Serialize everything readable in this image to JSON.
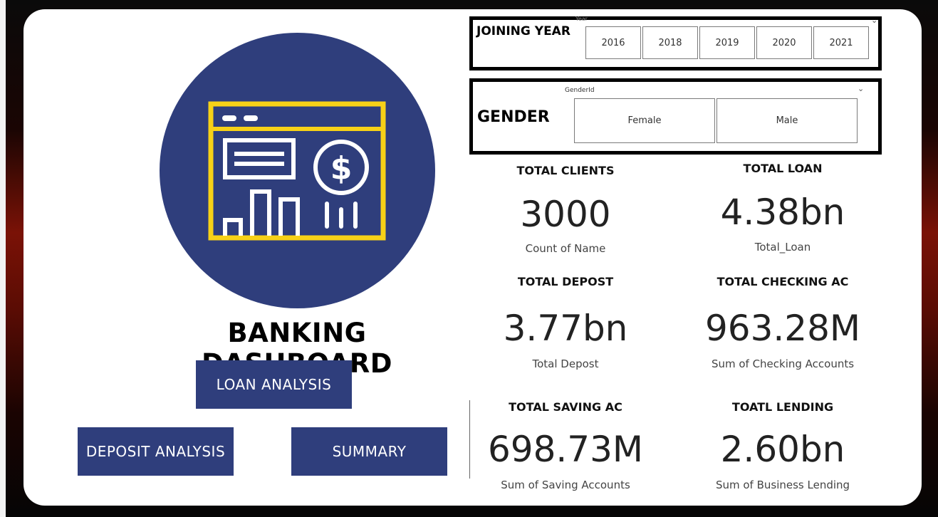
{
  "dashboard": {
    "title": "BANKING DASHBOARD",
    "logo_icon": "banking-dashboard-icon"
  },
  "navigation": {
    "loan_analysis": "LOAN ANALYSIS",
    "deposit_analysis": "DEPOSIT ANALYSIS",
    "summary": "SUMMARY"
  },
  "filters": {
    "joining_year": {
      "label": "JOINING YEAR",
      "field": "Year",
      "options": [
        "2016",
        "2018",
        "2019",
        "2020",
        "2021"
      ]
    },
    "gender": {
      "label": "GENDER",
      "field": "GenderId",
      "options": [
        "Female",
        "Male"
      ]
    }
  },
  "kpis": [
    {
      "heading": "TOTAL CLIENTS",
      "value": "3000",
      "caption": "Count of Name"
    },
    {
      "heading": "TOTAL LOAN",
      "value": "4.38bn",
      "caption": "Total_Loan"
    },
    {
      "heading": "TOTAL DEPOST",
      "value": "3.77bn",
      "caption": "Total Depost"
    },
    {
      "heading": "TOTAL CHECKING AC",
      "value": "963.28M",
      "caption": "Sum of Checking Accounts"
    },
    {
      "heading": "TOTAL SAVING AC",
      "value": "698.73M",
      "caption": "Sum of Saving Accounts"
    },
    {
      "heading": "TOATL LENDING",
      "value": "2.60bn",
      "caption": "Sum of Business Lending"
    }
  ],
  "colors": {
    "brand_navy": "#2f3e7c",
    "accent_yellow": "#f7d117",
    "background_red": "#7a1206"
  }
}
